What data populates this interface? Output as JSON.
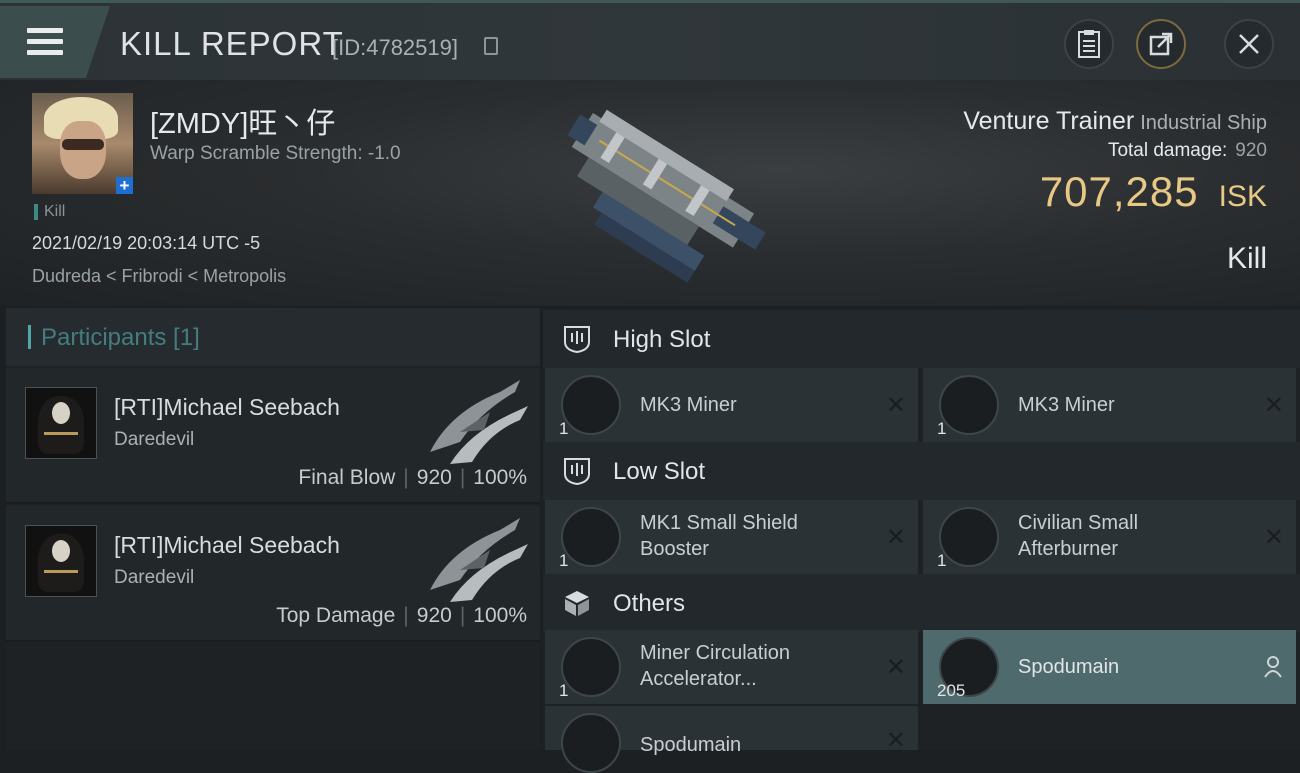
{
  "header": {
    "title": "KILL REPORT",
    "report_id": "[ID:4782519]"
  },
  "victim": {
    "pilot_name": "[ZMDY]旺丶仔",
    "warp_scramble": "Warp Scramble Strength: -1.0",
    "tag": "Kill",
    "datetime": "2021/02/19 20:03:14 UTC -5",
    "location": "Dudreda < Fribrodi < Metropolis",
    "ship_name": "Venture Trainer",
    "ship_class": "Industrial Ship",
    "damage_label": "Total damage:",
    "damage_value": "920",
    "isk_value": "707,285",
    "isk_unit": "ISK",
    "result": "Kill"
  },
  "participants": {
    "label": "Participants [1]",
    "rows": [
      {
        "name": "[RTI]Michael Seebach",
        "ship": "Daredevil",
        "role": "Final Blow",
        "damage": "920",
        "percent": "100%"
      },
      {
        "name": "[RTI]Michael Seebach",
        "ship": "Daredevil",
        "role": "Top Damage",
        "damage": "920",
        "percent": "100%"
      }
    ]
  },
  "fitting": {
    "high_slot": {
      "label": "High Slot",
      "items": [
        {
          "name": "MK3 Miner",
          "qty": "1",
          "icon": "miner-icon"
        },
        {
          "name": "MK3 Miner",
          "qty": "1",
          "icon": "miner-icon"
        }
      ]
    },
    "low_slot": {
      "label": "Low Slot",
      "items": [
        {
          "name_line1": "MK1 Small Shield",
          "name_line2": "Booster",
          "qty": "1",
          "icon": "shield-booster-icon"
        },
        {
          "name_line1": "Civilian Small",
          "name_line2": "Afterburner",
          "qty": "1",
          "icon": "afterburner-icon"
        }
      ]
    },
    "others": {
      "label": "Others",
      "items": [
        {
          "name_line1": "Miner Circulation",
          "name_line2": "Accelerator...",
          "qty": "1",
          "icon": "accelerator-icon"
        },
        {
          "name": "Spodumain",
          "qty": "205",
          "icon": "ore-icon",
          "highlighted": true
        },
        {
          "name": "Spodumain",
          "icon": "ore-icon"
        }
      ]
    }
  },
  "colors": {
    "accent_teal": "#4ea7a5",
    "isk_gold": "#e7c884",
    "highlight_row": "#4f6a6c"
  }
}
